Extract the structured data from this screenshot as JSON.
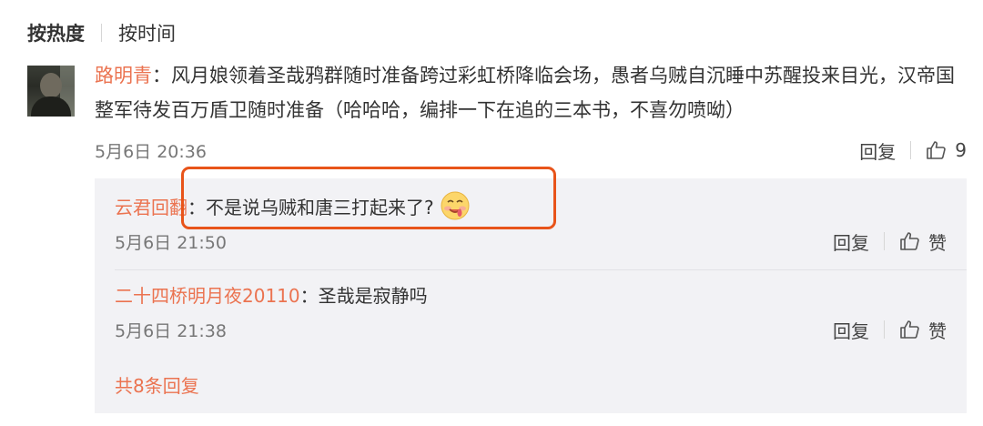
{
  "sort": {
    "hot_label": "按热度",
    "time_label": "按时间"
  },
  "comment": {
    "username": "路明青",
    "separator": "：",
    "text": "风月娘领着圣哉鸦群随时准备跨过彩虹桥降临会场，愚者乌贼自沉睡中苏醒投来目光，汉帝国整军待发百万盾卫随时准备（哈哈哈，编排一下在追的三本书，不喜勿喷呦）",
    "timestamp": "5月6日 20:36",
    "reply_label": "回复",
    "like_count": "9"
  },
  "replies": [
    {
      "username": "云君回翻",
      "separator": "：",
      "text": "不是说乌贼和唐三打起来了?",
      "emoji": "drooling-face-emoji",
      "timestamp": "5月6日 21:50",
      "reply_label": "回复",
      "like_label": "赞"
    },
    {
      "username": "二十四桥明月夜20110",
      "separator": "：",
      "text": "圣哉是寂静吗",
      "timestamp": "5月6日 21:38",
      "reply_label": "回复",
      "like_label": "赞"
    }
  ],
  "more_replies_label": "共8条回复",
  "colors": {
    "accent": "#eb7350",
    "highlight": "#e8541a",
    "reply_bg": "#f2f2f5"
  }
}
